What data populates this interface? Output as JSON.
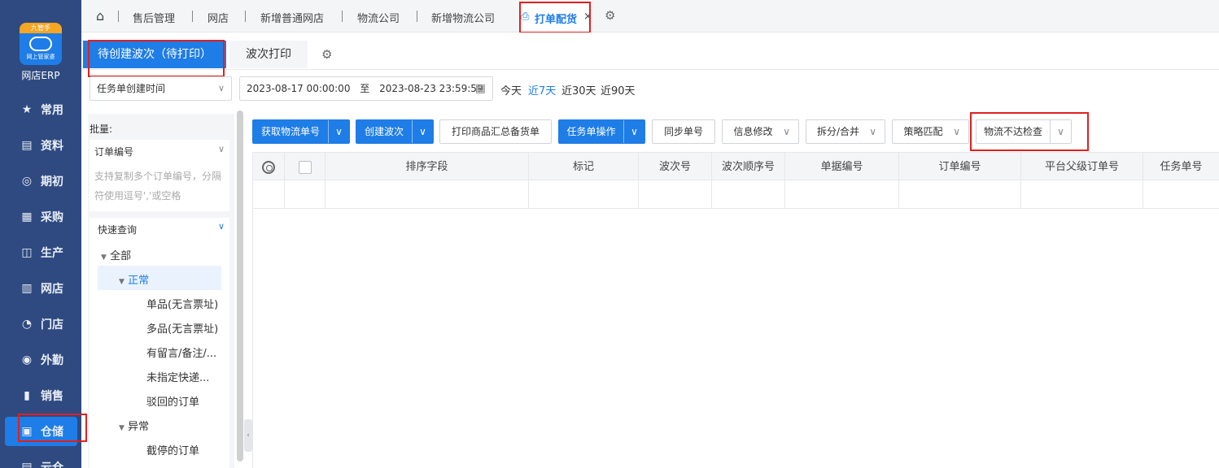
{
  "nav": {
    "logo_top": "九管手",
    "logo_sub": "网上管家婆",
    "brand": "网店ERP",
    "items": [
      {
        "label": "常用",
        "icon": "star-icon"
      },
      {
        "label": "资料",
        "icon": "document-icon"
      },
      {
        "label": "期初",
        "icon": "target-icon"
      },
      {
        "label": "采购",
        "icon": "purchase-icon"
      },
      {
        "label": "生产",
        "icon": "production-icon"
      },
      {
        "label": "网店",
        "icon": "store-icon"
      },
      {
        "label": "门店",
        "icon": "pie-icon"
      },
      {
        "label": "外勤",
        "icon": "field-icon"
      },
      {
        "label": "销售",
        "icon": "sales-chart-icon"
      },
      {
        "label": "仓储",
        "icon": "warehouse-icon"
      },
      {
        "label": "云仓",
        "icon": "cloud-warehouse-icon"
      }
    ],
    "active": "仓储"
  },
  "tabbar": {
    "tabs": [
      "售后管理",
      "网店",
      "新增普通网店",
      "物流公司",
      "新增物流公司",
      "打单配货"
    ],
    "active": "打单配货"
  },
  "subtabs": {
    "active": "待创建波次（待打印）",
    "other": "波次打印"
  },
  "filter": {
    "date_field": "任务单创建时间",
    "start": "2023-08-17 00:00:00",
    "to": "至",
    "end": "2023-08-23 23:59:59",
    "quick": [
      "今天",
      "近7天",
      "近30天",
      "近90天"
    ],
    "quick_active": "近7天"
  },
  "leftpanel": {
    "batch_label": "批量:",
    "batch_field": "订单编号",
    "batch_placeholder_1": "支持复制多个订单编号，分隔",
    "batch_placeholder_2": "符使用逗号','或空格",
    "quick_query": "快速查询",
    "tree": {
      "all": "全部",
      "normal": "正常",
      "normal_children": [
        "单品(无言票址)",
        "多品(无言票址)",
        "有留言/备注/...",
        "未指定快递...",
        "驳回的订单"
      ],
      "abnormal": "异常",
      "abnormal_children": [
        "截停的订单"
      ]
    }
  },
  "toolbar": {
    "get_logistics_no": "获取物流单号",
    "create_wave": "创建波次",
    "print_summary": "打印商品汇总备货单",
    "task_ops": "任务单操作",
    "sync_no": "同步单号",
    "info_edit": "信息修改",
    "split_merge": "拆分/合并",
    "strategy_match": "策略匹配",
    "logistics_check": "物流不达检查"
  },
  "table": {
    "columns": [
      "排序字段",
      "标记",
      "波次号",
      "波次顺序号",
      "单据编号",
      "订单编号",
      "平台父级订单号",
      "任务单号"
    ]
  },
  "colors": {
    "nav_bg": "#2f4a80",
    "accent": "#1e7de6",
    "highlight": "#e02020"
  }
}
